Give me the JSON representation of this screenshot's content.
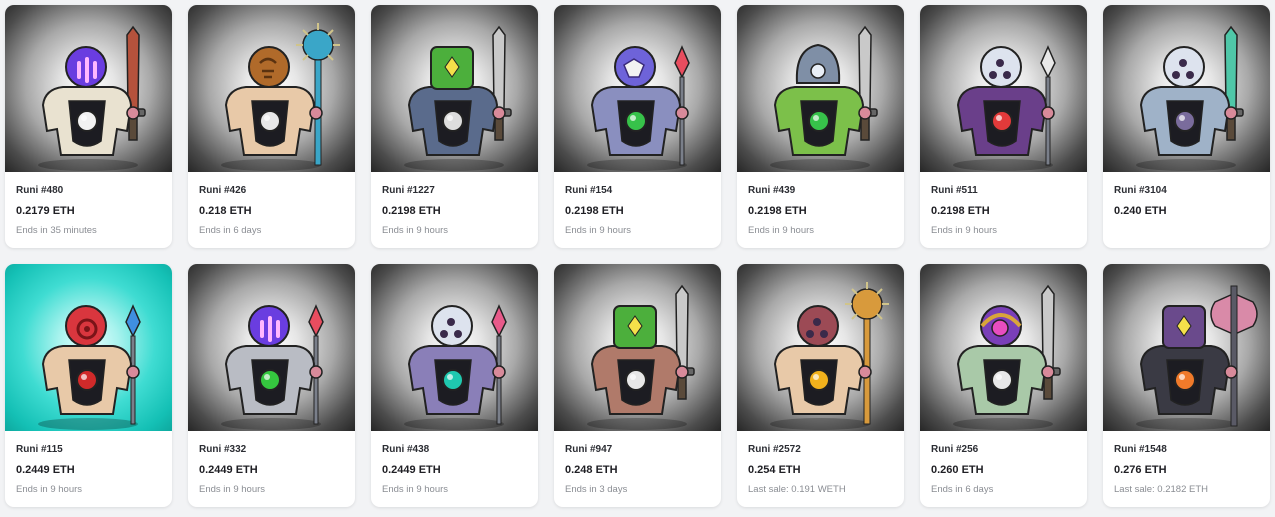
{
  "cards": [
    {
      "name": "Runi #480",
      "price": "0.2179 ETH",
      "status": "Ends in 35 minutes",
      "bg": "dark",
      "head_color": "#6a3de0",
      "head_icon": "bars-icon",
      "weapon": "sword",
      "weapon_color": "#b5523c",
      "body_color": "#e9e2d0",
      "gem_color": "#f2f2f2"
    },
    {
      "name": "Runi #426",
      "price": "0.218 ETH",
      "status": "Ends in 6 days",
      "bg": "dark",
      "head_color": "#b06a2a",
      "head_icon": "rune-icon",
      "weapon": "mace",
      "weapon_color": "#3aa6c8",
      "body_color": "#e8c9a8",
      "gem_color": "#e8e8e8"
    },
    {
      "name": "Runi #1227",
      "price": "0.2198 ETH",
      "status": "Ends in 9 hours",
      "bg": "dark",
      "head_color": "#4caf3c",
      "head_icon": "cube-icon",
      "weapon": "sword",
      "weapon_color": "#c9c9c9",
      "body_color": "#5a6b8c",
      "gem_color": "#dddddd"
    },
    {
      "name": "Runi #154",
      "price": "0.2198 ETH",
      "status": "Ends in 9 hours",
      "bg": "dark",
      "head_color": "#6e63d9",
      "head_icon": "mask-icon",
      "weapon": "spear",
      "weapon_color": "#e84d5f",
      "body_color": "#8a8fbf",
      "gem_color": "#37c24a"
    },
    {
      "name": "Runi #439",
      "price": "0.2198 ETH",
      "status": "Ends in 9 hours",
      "bg": "dark",
      "head_color": "#7f8fa6",
      "head_icon": "shell-icon",
      "weapon": "sword",
      "weapon_color": "#c9c9c9",
      "body_color": "#7cc04a",
      "gem_color": "#37c24a"
    },
    {
      "name": "Runi #511",
      "price": "0.2198 ETH",
      "status": "Ends in 9 hours",
      "bg": "dark",
      "head_color": "#dde3ee",
      "head_icon": "orb-icon",
      "weapon": "spear",
      "weapon_color": "#e8e8e8",
      "body_color": "#6a3f8a",
      "gem_color": "#e23a3a"
    },
    {
      "name": "Runi #3104",
      "price": "0.240 ETH",
      "status": "",
      "bg": "dark",
      "head_color": "#dde3ee",
      "head_icon": "orb-icon",
      "weapon": "sword",
      "weapon_color": "#4fc7a8",
      "body_color": "#9fb2c8",
      "gem_color": "#7a6c9c"
    },
    {
      "name": "Runi #115",
      "price": "0.2449 ETH",
      "status": "Ends in 9 hours",
      "bg": "teal",
      "head_color": "#d9363e",
      "head_icon": "swirl-icon",
      "weapon": "spear",
      "weapon_color": "#3f8fe0",
      "body_color": "#e8c9a8",
      "gem_color": "#d12a2a"
    },
    {
      "name": "Runi #332",
      "price": "0.2449 ETH",
      "status": "Ends in 9 hours",
      "bg": "dark",
      "head_color": "#6a3de0",
      "head_icon": "bars-icon",
      "weapon": "spear",
      "weapon_color": "#e84d5f",
      "body_color": "#b9bcc4",
      "gem_color": "#35c73f"
    },
    {
      "name": "Runi #438",
      "price": "0.2449 ETH",
      "status": "Ends in 9 hours",
      "bg": "dark",
      "head_color": "#dde3ee",
      "head_icon": "orb-icon",
      "weapon": "spear",
      "weapon_color": "#e85a8a",
      "body_color": "#8a7fb8",
      "gem_color": "#1fc8b0"
    },
    {
      "name": "Runi #947",
      "price": "0.248 ETH",
      "status": "Ends in 3 days",
      "bg": "dark",
      "head_color": "#4caf3c",
      "head_icon": "cube-icon",
      "weapon": "sword",
      "weapon_color": "#c9c9c9",
      "body_color": "#b07a6a",
      "gem_color": "#e8e8e8"
    },
    {
      "name": "Runi #2572",
      "price": "0.254 ETH",
      "status": "Last sale: 0.191 WETH",
      "bg": "dark",
      "head_color": "#9c4a55",
      "head_icon": "orb-icon",
      "weapon": "mace",
      "weapon_color": "#d89a3c",
      "body_color": "#e8c9a8",
      "gem_color": "#f2b21c"
    },
    {
      "name": "Runi #256",
      "price": "0.260 ETH",
      "status": "Ends in 6 days",
      "bg": "dark",
      "head_color": "#7a3fb8",
      "head_icon": "helm-icon",
      "weapon": "sword",
      "weapon_color": "#c9c9c9",
      "body_color": "#a9c9a8",
      "gem_color": "#e8e8e8"
    },
    {
      "name": "Runi #1548",
      "price": "0.276 ETH",
      "status": "Last sale: 0.2182 ETH",
      "bg": "dark",
      "head_color": "#6a4a8c",
      "head_icon": "cube-icon",
      "weapon": "axe",
      "weapon_color": "#d98aa8",
      "body_color": "#3a3a44",
      "gem_color": "#f07a2a"
    }
  ]
}
